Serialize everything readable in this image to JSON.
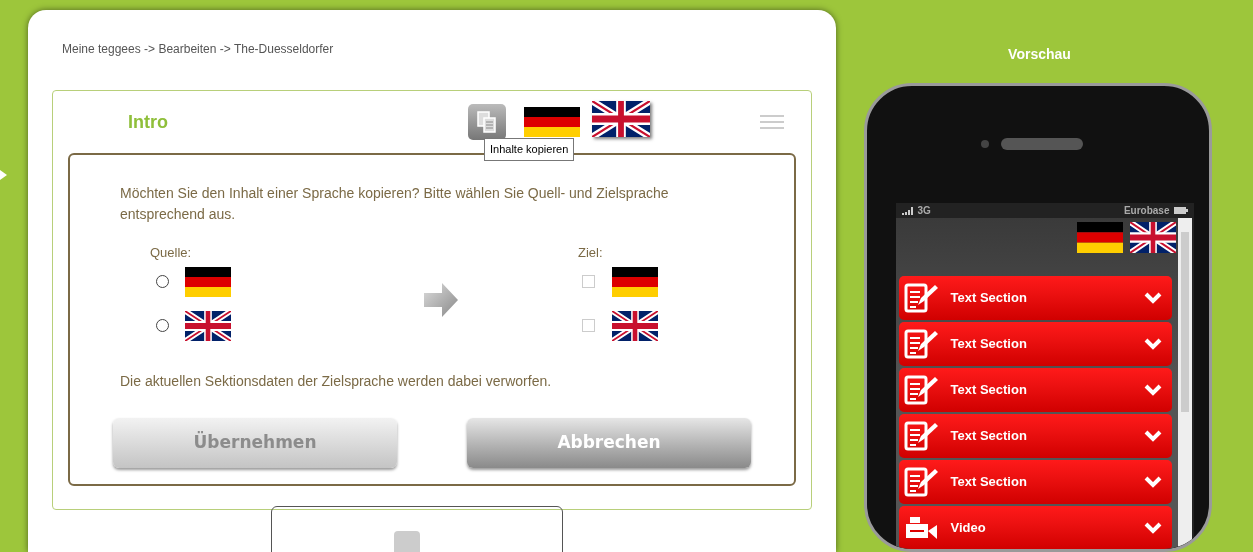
{
  "breadcrumb": "Meine teggees -> Bearbeiten -> The-Duesseldorfer",
  "card": {
    "title": "Intro",
    "tooltip": "Inhalte kopieren",
    "flags": [
      {
        "kind": "de"
      },
      {
        "kind": "gb"
      }
    ]
  },
  "dialog": {
    "message": "Möchten Sie den Inhalt einer Sprache kopieren? Bitte wählen Sie Quell- und Zielsprache entsprechend aus.",
    "source": {
      "label": "Quelle:",
      "options": [
        {
          "kind": "de",
          "selected": false
        },
        {
          "kind": "gb",
          "selected": false
        }
      ]
    },
    "target": {
      "label": "Ziel:",
      "options": [
        {
          "kind": "de",
          "checked": false
        },
        {
          "kind": "gb",
          "checked": false
        }
      ]
    },
    "note": "Die aktuellen Sektionsdaten der Zielsprache werden dabei verworfen.",
    "buttons": [
      {
        "label": "Übernehmen",
        "disabled": true
      },
      {
        "label": "Abbrechen",
        "disabled": false
      }
    ]
  },
  "preview": {
    "title": "Vorschau",
    "network": "3G",
    "carrier": "Eurobase",
    "flags": [
      {
        "kind": "de"
      },
      {
        "kind": "gb"
      }
    ],
    "sections": [
      {
        "kind": "text",
        "label": "Text Section"
      },
      {
        "kind": "text",
        "label": "Text Section"
      },
      {
        "kind": "text",
        "label": "Text Section"
      },
      {
        "kind": "text",
        "label": "Text Section"
      },
      {
        "kind": "text",
        "label": "Text Section"
      },
      {
        "kind": "video",
        "label": "Video"
      }
    ]
  }
}
